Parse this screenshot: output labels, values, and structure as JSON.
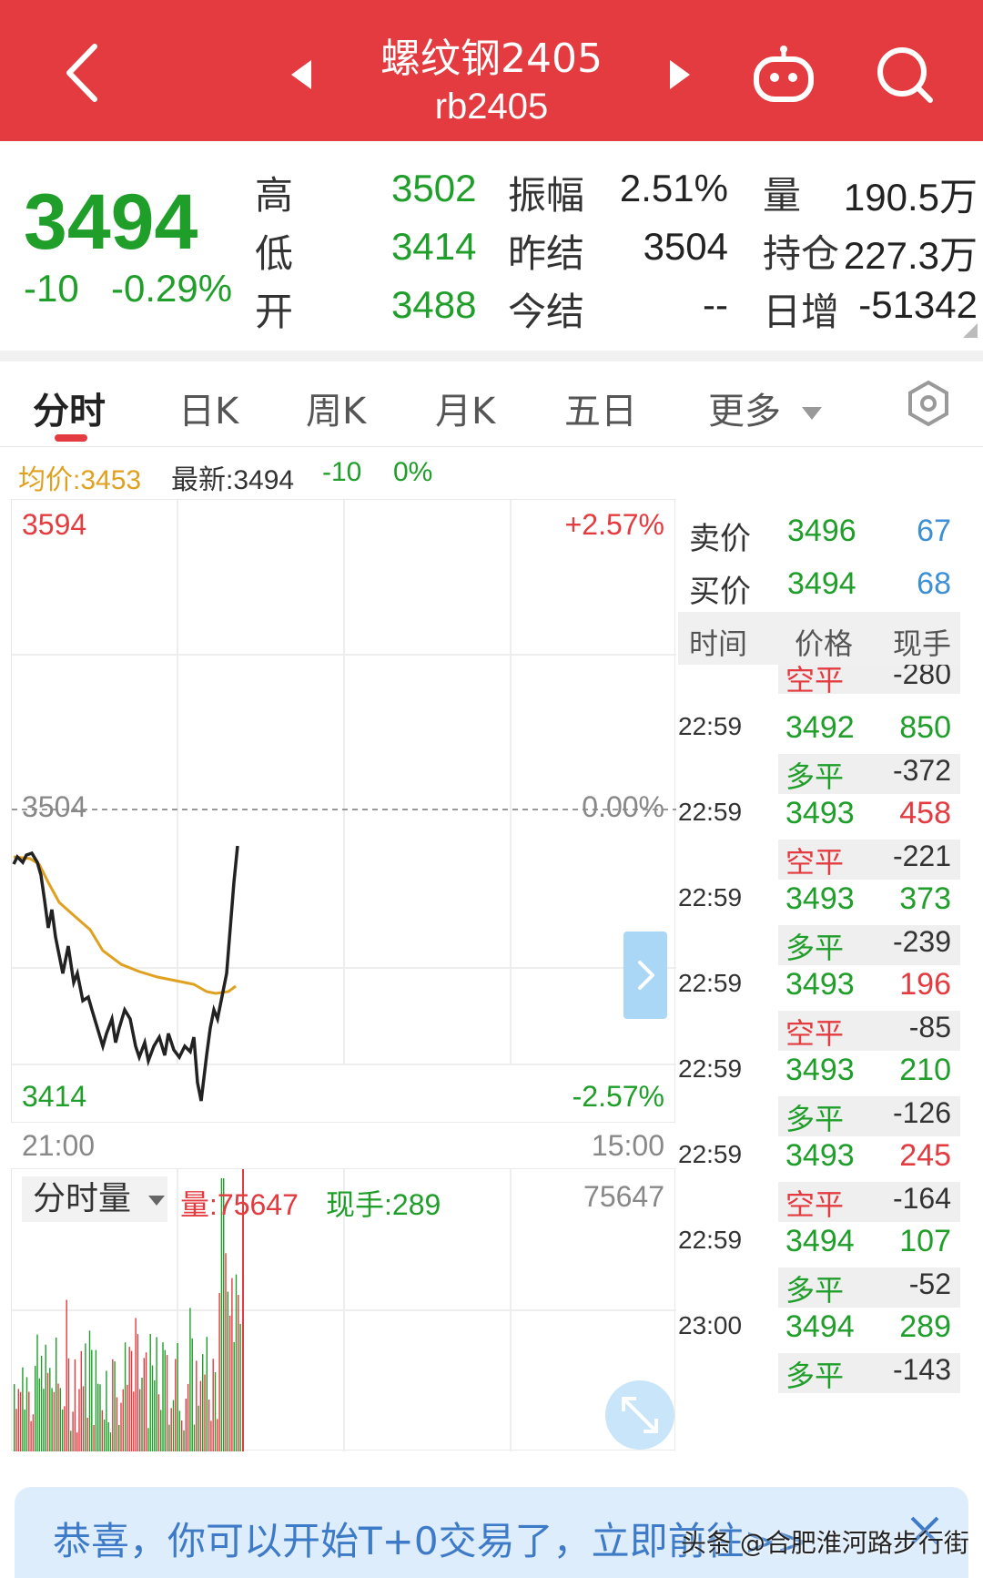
{
  "header": {
    "title": "螺纹钢2405",
    "subtitle": "rb2405",
    "bg_color": "#e33b3f"
  },
  "quote": {
    "last_price": "3494",
    "change": "-10",
    "change_pct": "-0.29%",
    "high_label": "高",
    "high": "3502",
    "low_label": "低",
    "low": "3414",
    "open_label": "开",
    "open": "3488",
    "amplitude_label": "振幅",
    "amplitude": "2.51%",
    "prev_settle_label": "昨结",
    "prev_settle": "3504",
    "settle_label": "今结",
    "settle": "--",
    "volume_label": "量",
    "volume": "190.5万",
    "open_interest_label": "持仓",
    "open_interest": "227.3万",
    "daily_change_label": "日增",
    "daily_change": "-51342"
  },
  "tabs": [
    "分时",
    "日K",
    "周K",
    "月K",
    "五日",
    "更多"
  ],
  "info_line": {
    "avg": "均价:3453",
    "latest": "最新:3494",
    "change": "-10",
    "pct": "0%"
  },
  "chart_labels": {
    "top_price": "3594",
    "top_pct": "+2.57%",
    "mid_price": "3504",
    "mid_pct": "0.00%",
    "bottom_price": "3414",
    "bottom_pct": "-2.57%",
    "start_time": "21:00",
    "end_time": "15:00"
  },
  "volume": {
    "dropdown_label": "分时量",
    "vol_text": "量:75647",
    "hand_text": "现手:289",
    "max": "75647"
  },
  "order_book": {
    "ask_label": "卖价",
    "ask_price": "3496",
    "ask_qty": "67",
    "bid_label": "买价",
    "bid_price": "3494",
    "bid_qty": "68"
  },
  "trades_header": [
    "时间",
    "价格",
    "现手"
  ],
  "trades_partial": {
    "type": "空平",
    "oi": "-280"
  },
  "trades": [
    {
      "time": "22:59",
      "price": "3492",
      "qty": "850",
      "qty_color": "green",
      "type": "多平",
      "oi": "-372"
    },
    {
      "time": "22:59",
      "price": "3493",
      "qty": "458",
      "qty_color": "red",
      "type": "空平",
      "oi": "-221"
    },
    {
      "time": "22:59",
      "price": "3493",
      "qty": "373",
      "qty_color": "green",
      "type": "多平",
      "oi": "-239"
    },
    {
      "time": "22:59",
      "price": "3493",
      "qty": "196",
      "qty_color": "red",
      "type": "空平",
      "oi": "-85"
    },
    {
      "time": "22:59",
      "price": "3493",
      "qty": "210",
      "qty_color": "green",
      "type": "多平",
      "oi": "-126"
    },
    {
      "time": "22:59",
      "price": "3493",
      "qty": "245",
      "qty_color": "red",
      "type": "空平",
      "oi": "-164"
    },
    {
      "time": "22:59",
      "price": "3494",
      "qty": "107",
      "qty_color": "green",
      "type": "多平",
      "oi": "-52"
    },
    {
      "time": "23:00",
      "price": "3494",
      "qty": "289",
      "qty_color": "green",
      "type": "多平",
      "oi": "-143"
    }
  ],
  "banner": {
    "text": "恭喜，你可以开始T+0交易了，立即前往>>",
    "watermark": "头条 @合肥淮河路步行街"
  },
  "colors": {
    "up": "#e33b3f",
    "down": "#1f9e2a",
    "avg_line": "#e0a020",
    "price_line": "#222222"
  }
}
